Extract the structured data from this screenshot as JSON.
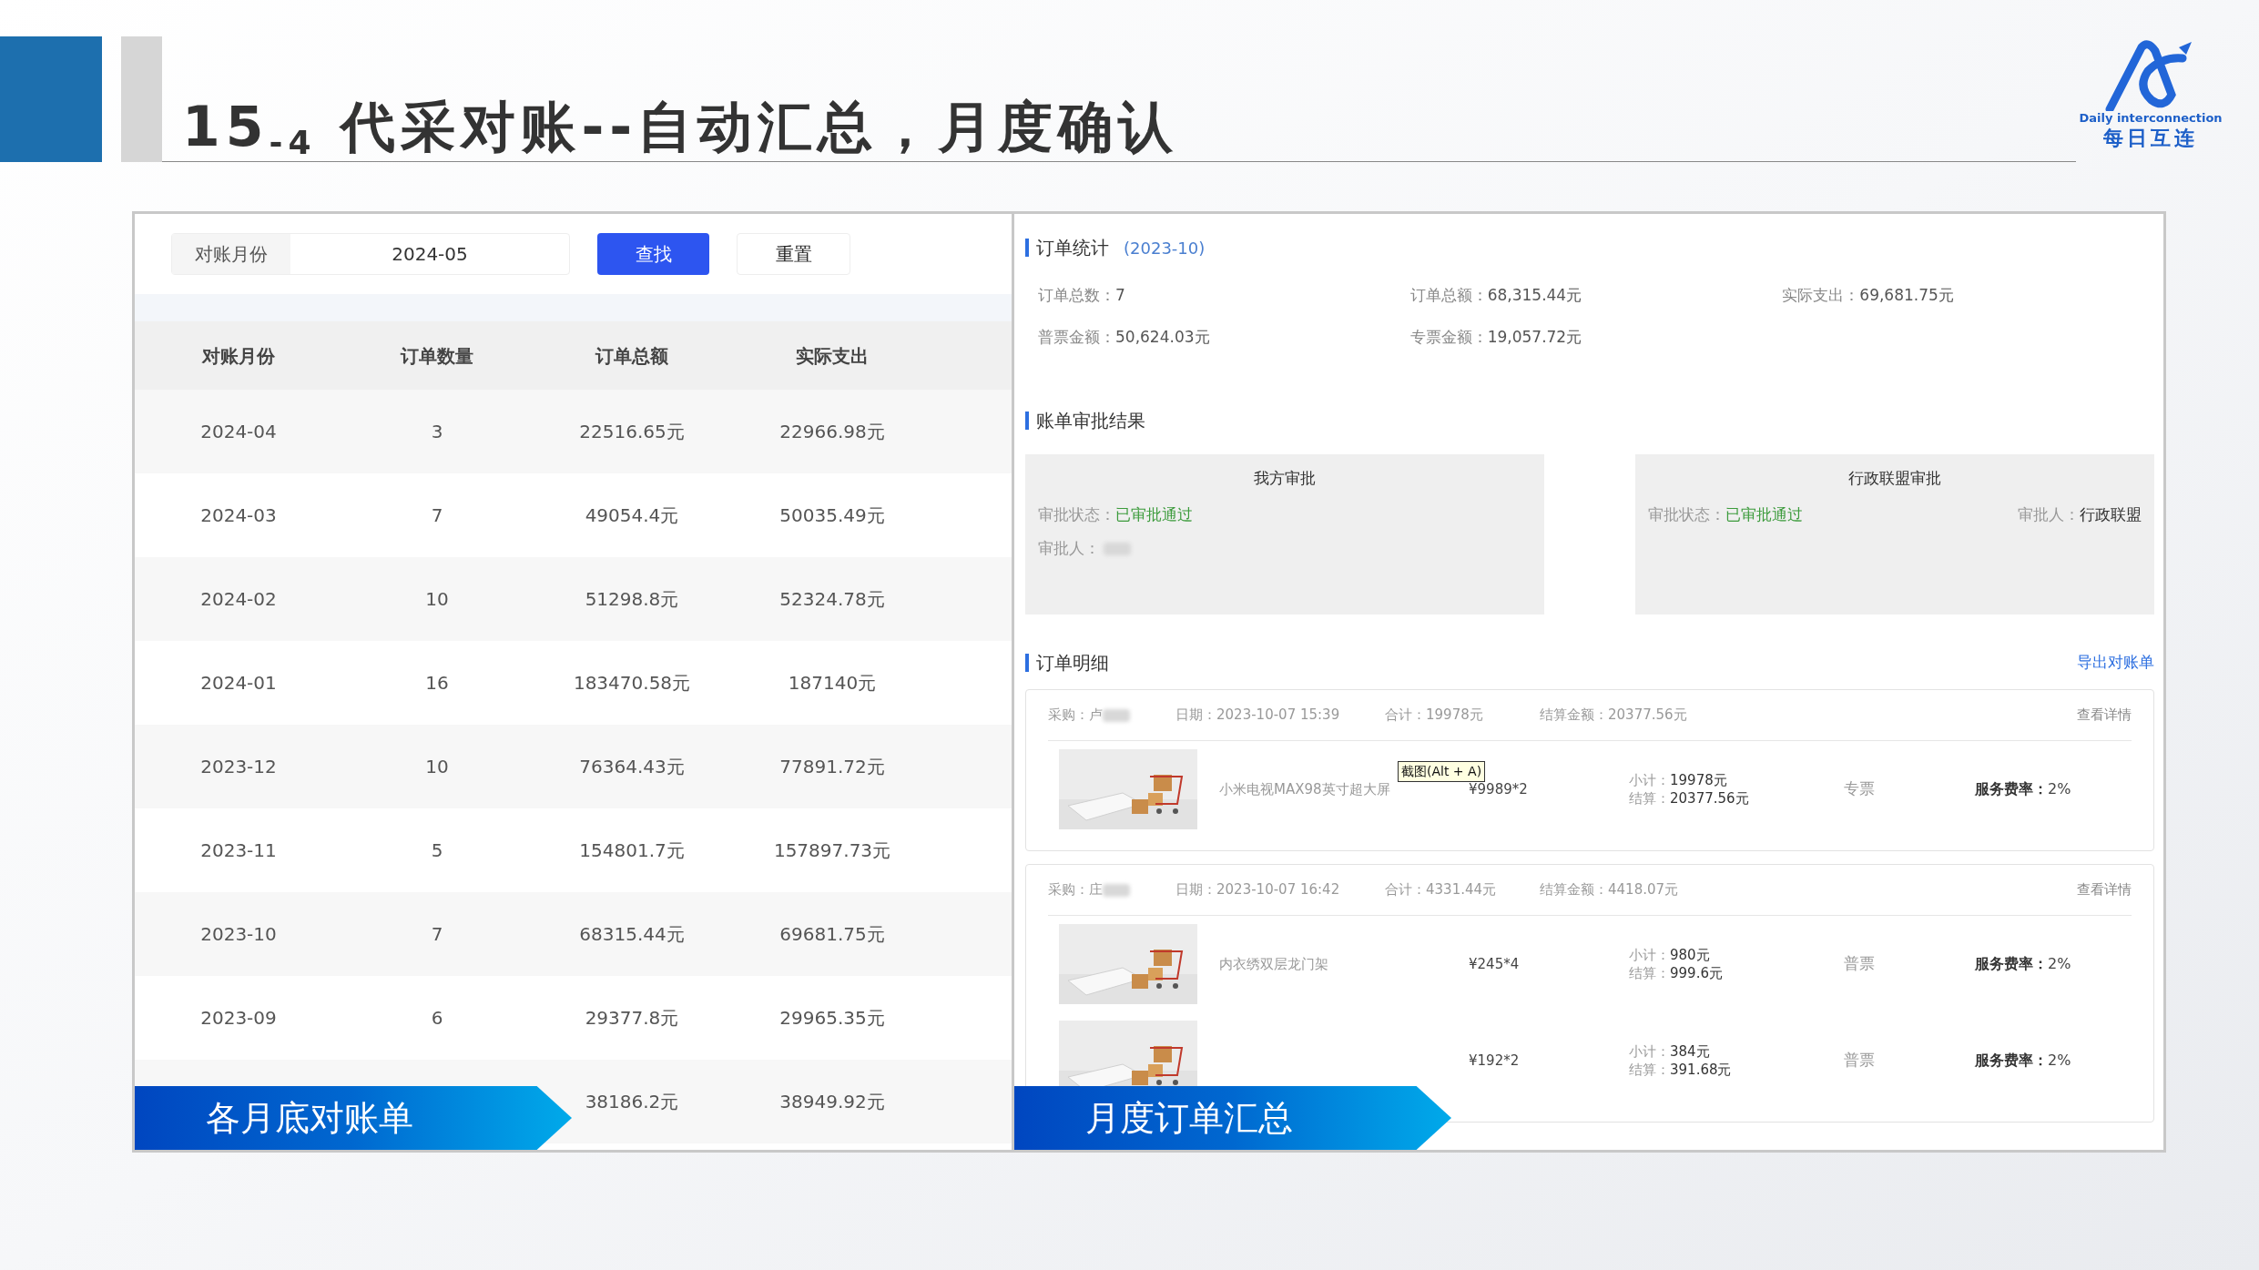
{
  "header": {
    "title": "15$_{-4}$ 代采对账--自动汇总，月度确认",
    "logo_text": "Daily interconnection",
    "logo_name": "每日互连"
  },
  "left_panel": {
    "filter": {
      "label": "对账月份",
      "value": "2024-05",
      "buttons": [
        {
          "label": "查找",
          "kind": "primary"
        },
        {
          "label": "重置",
          "kind": "default"
        }
      ]
    },
    "table": {
      "columns": [
        "对账月份",
        "订单数量",
        "订单总额",
        "实际支出"
      ],
      "rows": [
        [
          "2024-04",
          "3",
          "22516.65元",
          "22966.98元"
        ],
        [
          "2024-03",
          "7",
          "49054.4元",
          "50035.49元"
        ],
        [
          "2024-02",
          "10",
          "51298.8元",
          "52324.78元"
        ],
        [
          "2024-01",
          "16",
          "183470.58元",
          "187140元"
        ],
        [
          "2023-12",
          "10",
          "76364.43元",
          "77891.72元"
        ],
        [
          "2023-11",
          "5",
          "154801.7元",
          "157897.73元"
        ],
        [
          "2023-10",
          "7",
          "68315.44元",
          "69681.75元"
        ],
        [
          "2023-09",
          "6",
          "29377.8元",
          "29965.35元"
        ],
        [
          null,
          null,
          "38186.2元",
          "38949.92元"
        ]
      ]
    },
    "banner": "各月底对账单"
  },
  "right_panel": {
    "stats": {
      "title": "订单统计",
      "period": "(2023-10)",
      "items": [
        {
          "label": "订单总数：",
          "value": "7"
        },
        {
          "label": "订单总额：",
          "value": "68,315.44元"
        },
        {
          "label": "实际支出：",
          "value": "69,681.75元"
        },
        {
          "label": "普票金额：",
          "value": "50,624.03元"
        },
        {
          "label": "专票金额：",
          "value": "19,057.72元"
        }
      ]
    },
    "approval": {
      "title": "账单审批结果",
      "boxes": [
        {
          "title": "我方审批",
          "status_label": "审批状态：",
          "status": "已审批通过",
          "approver_label": "审批人：",
          "kind": "stacked"
        },
        {
          "title": "行政联盟审批",
          "status_label": "审批状态：",
          "status": "已审批通过",
          "approver_label": "审批人：",
          "approver": "行政联盟",
          "kind": "inline"
        }
      ]
    },
    "orders": {
      "title": "订单明细",
      "export_link": "导出对账单",
      "tooltip": "截图(Alt + A)",
      "cards": [
        {
          "buyer": "采购：卢",
          "date": "日期：2023-10-07 15:39",
          "total": "合计：19978元",
          "settle_total": "结算金额：20377.56元",
          "detail_link": "查看详情",
          "items": [
            {
              "name": "小米电视MAX98英寸超大屏",
              "price": "¥9989*2",
              "subtotal_label": "小计：",
              "subtotal": "19978元",
              "settle_label": "结算：",
              "settle": "20377.56元",
              "invoice": "专票",
              "fee_label": "服务费率：",
              "fee": "2%"
            }
          ]
        },
        {
          "buyer": "采购：庄",
          "date": "日期：2023-10-07 16:42",
          "total": "合计：4331.44元",
          "settle_total": "结算金额：4418.07元",
          "detail_link": "查看详情",
          "items": [
            {
              "name": "内衣绣双层龙门架",
              "price": "¥245*4",
              "subtotal_label": "小计：",
              "subtotal": "980元",
              "settle_label": "结算：",
              "settle": "999.6元",
              "invoice": "普票",
              "fee_label": "服务费率：",
              "fee": "2%"
            },
            {
              "price": "¥192*2",
              "subtotal_label": "小计：",
              "subtotal": "384元",
              "settle_label": "结算：",
              "settle": "391.68元",
              "invoice": "普票",
              "fee_label": "服务费率：",
              "fee": "2%"
            }
          ]
        }
      ]
    },
    "banner": "月度订单汇总"
  }
}
